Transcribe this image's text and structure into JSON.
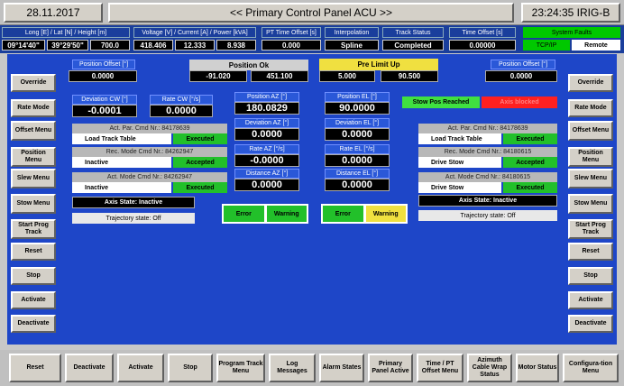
{
  "top": {
    "date": "28.11.2017",
    "title": "<< Primary Control Panel ACU >>",
    "time": "23:24:35 IRIG-B"
  },
  "info": {
    "pos_header": "Long [E]  /  Lat [N]  /  Height [m]",
    "long": "09°14'40\"",
    "lat": "39°29'50\"",
    "height": "700.0",
    "power_header": "Voltage [V] / Current [A] / Power [kVA]",
    "voltage": "418.406",
    "current": "12.333",
    "power": "8.938",
    "pt_header": "PT Time Offset [s]",
    "pt_value": "0.000",
    "interp_header": "Interpolation",
    "interp_value": "Spline",
    "track_header": "Track Status",
    "track_value": "Completed",
    "toff_header": "Time Offset [s]",
    "toff_value": "0.00000",
    "faults": "System Faults",
    "tcpip": "TCP/IP",
    "remote": "Remote"
  },
  "left_menu": [
    "Override",
    "Rate Mode",
    "Offset Menu",
    "Position Menu",
    "Slew Menu",
    "Stow Menu",
    "Start Prog Track",
    "Reset",
    "Stop",
    "Activate",
    "Deactivate"
  ],
  "right_menu": [
    "Override",
    "Rate Mode",
    "Offset Menu",
    "Position Menu",
    "Slew Menu",
    "Stow Menu",
    "Start Prog Track",
    "Reset",
    "Stop",
    "Activate",
    "Deactivate"
  ],
  "az": {
    "pos_offset_label": "Position Offset [°]",
    "pos_offset": "0.0000",
    "dev_cw_label": "Deviation CW [°]",
    "dev_cw": "-0.0001",
    "rate_cw_label": "Rate  CW [°/s]",
    "rate_cw": "0.0000",
    "act_par_label": "Act. Par. Cmd Nr.: 84178639",
    "act_par_cmd": "Load Track Table",
    "act_par_status": "Executed",
    "rec_mode_label": "Rec. Mode Cmd Nr.: 84262947",
    "rec_mode_cmd": "Inactive",
    "rec_mode_status": "Accepted",
    "act_mode_label": "Act. Mode Cmd Nr.: 84262947",
    "act_mode_cmd": "Inactive",
    "act_mode_status": "Executed",
    "axis_state": "Axis State: Inactive",
    "traj_state": "Trajectory state: Off"
  },
  "center": {
    "pos_ok": "Position Ok",
    "pos_ok_az": "-91.020",
    "pos_ok_el": "451.100",
    "pre_limit": "Pre Limit Up",
    "pre_limit_a": "5.000",
    "pre_limit_b": "90.500",
    "pos_az_label": "Position AZ [°]",
    "pos_az": "180.0829",
    "dev_az_label": "Deviation AZ [°]",
    "dev_az": "0.0000",
    "rate_az_label": "Rate  AZ [°/s]",
    "rate_az": "-0.0000",
    "dist_az_label": "Distance AZ [°]",
    "dist_az": "0.0000",
    "pos_el_label": "Position EL [°]",
    "pos_el": "90.0000",
    "dev_el_label": "Deviation EL [°]",
    "dev_el": "0.0000",
    "rate_el_label": "Rate EL [°/s]",
    "rate_el": "0.0000",
    "dist_el_label": "Distance EL [°]",
    "dist_el": "0.0000",
    "error": "Error",
    "warning": "Warning"
  },
  "el": {
    "pos_offset_label": "Position Offset [°]",
    "pos_offset": "0.0000",
    "stow_reached": "Stow Pos Reached",
    "axis_blocked": "Axis blocked",
    "act_par_label": "Act. Par. Cmd Nr.: 84178639",
    "act_par_cmd": "Load Track Table",
    "act_par_status": "Executed",
    "rec_mode_label": "Rec. Mode Cmd Nr.: 84180615",
    "rec_mode_cmd": "Drive Stow",
    "rec_mode_status": "Accepted",
    "act_mode_label": "Act. Mode Cmd Nr.: 84180615",
    "act_mode_cmd": "Drive Stow",
    "act_mode_status": "Executed",
    "axis_state": "Axis State: Inactive",
    "traj_state": "Trajectory state: Off"
  },
  "bottom_menu": [
    "Reset",
    "Deactivate",
    "Activate",
    "Stop",
    "Program Track Menu",
    "Log Messages",
    "Alarm States",
    "Primary Panel Active",
    "Time / PT Offset Menu",
    "Azimuth Cable Wrap Status",
    "Motor Status",
    "Configura-tion Menu"
  ]
}
